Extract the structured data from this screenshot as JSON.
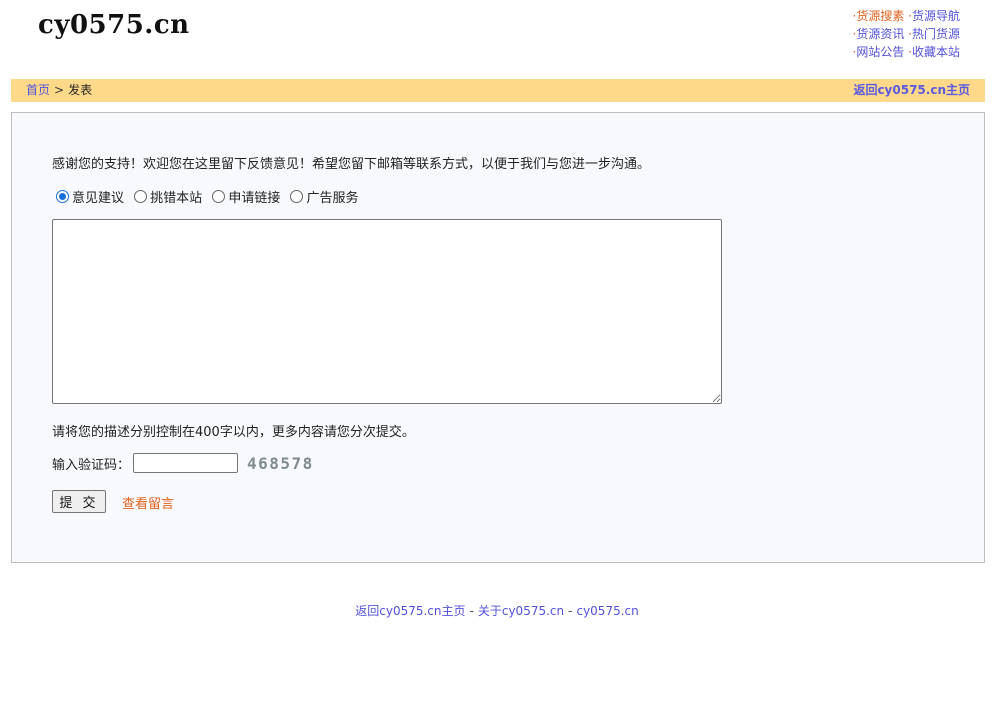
{
  "site": {
    "logo": "cy0575.cn"
  },
  "toplinks": [
    [
      {
        "label": "货源搜素",
        "hot": true
      },
      {
        "label": "货源导航",
        "hot": false
      }
    ],
    [
      {
        "label": "货源资讯",
        "hot": false
      },
      {
        "label": "热门货源",
        "hot": false
      }
    ],
    [
      {
        "label": "网站公告",
        "hot": false
      },
      {
        "label": "收藏本站",
        "hot": false
      }
    ]
  ],
  "breadcrumb": {
    "home": "首页",
    "separator": ">",
    "current": "发表"
  },
  "bar": {
    "home_link": "返回cy0575.cn主页"
  },
  "form": {
    "intro": "感谢您的支持！欢迎您在这里留下反馈意见！希望您留下邮箱等联系方式，以便于我们与您进一步沟通。",
    "options": [
      {
        "label": "意见建议",
        "checked": true
      },
      {
        "label": "挑错本站",
        "checked": false
      },
      {
        "label": "申请链接",
        "checked": false
      },
      {
        "label": "广告服务",
        "checked": false
      }
    ],
    "message_value": "",
    "note": "请将您的描述分别控制在400字以内，更多内容请您分次提交。",
    "captcha_label": "输入验证码：",
    "captcha_value": "",
    "captcha_code": "468578",
    "submit_label": "提 交",
    "view_link": "查看留言"
  },
  "footer": {
    "links": [
      "返回cy0575.cn主页",
      "关于cy0575.cn",
      "cy0575.cn"
    ],
    "separator": "-"
  },
  "colors": {
    "bar_bg": "#ffd98a",
    "link": "#5252d9",
    "accent_orange": "#e0621f",
    "panel_bg": "#f7f9fd"
  }
}
